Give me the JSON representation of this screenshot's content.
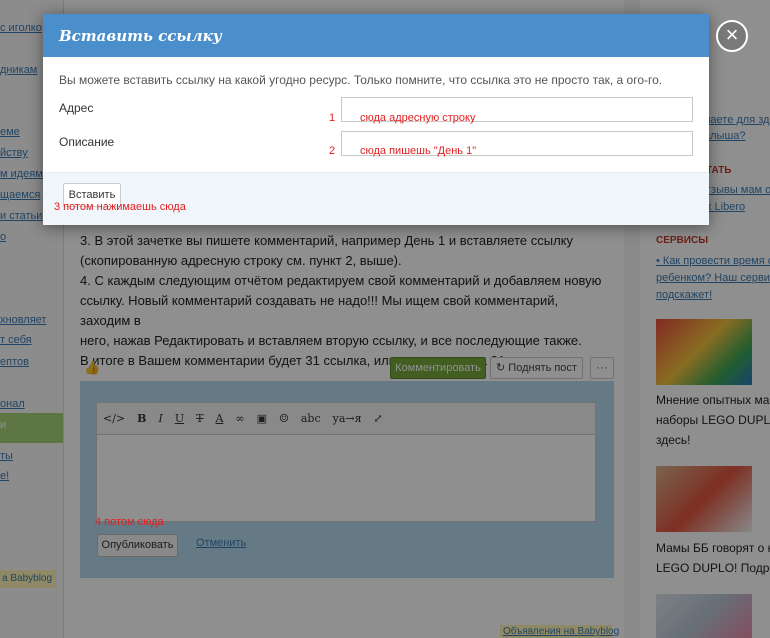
{
  "left_nav": {
    "items": [
      "с иголко",
      "дникам",
      "еме",
      "йству",
      "м идеями",
      "щаемся",
      "и статьи",
      "о",
      "хновляет",
      "т себя",
      "ептов",
      "",
      "онал",
      "и",
      "ты",
      "е!"
    ],
    "ad": "а Babyblog"
  },
  "post": {
    "lines": [
      "3. В этой зачетке вы пишете комментарий, например День 1 и вставляете ссылку",
      "(скопированную адресную строку см. пункт 2, выше).",
      "4. С каждым следующим отчётом редактируем свой комментарий и добавляем новую",
      "ссылку. Новый комментарий создавать не надо!!! Мы ищем свой комментарий, заходим в",
      "него, нажав Редактировать и вставляем вторую ссылку, и все последующие также.",
      "В итоге в Вашем комментарии будет 31 ссылка, или меньше, но на 31день."
    ],
    "comment_button": "Комментировать",
    "lift_button": "Поднять пост",
    "more_button": "···"
  },
  "editor": {
    "toolbar": [
      "</>",
      "B",
      "I",
      "U",
      "T",
      "A",
      "∞",
      "▣",
      "☺",
      "abc",
      "ya→я",
      "⤢"
    ],
    "publish_button": "Опубликовать",
    "cancel_link": "Отменить"
  },
  "ads_bottom": "Объявления на Babyblog",
  "right_col": {
    "top_links": [
      "лаете для здо",
      "алыша?"
    ],
    "heading1": "ТАТЬ",
    "reviews": [
      "тзывы мам о",
      "x Libero"
    ],
    "heading2": "СЕРВИСЫ",
    "service_lines": [
      "• Как провести время с",
      "ребенком? Наш сервис",
      "подскажет!"
    ],
    "item1_lines": [
      "Мнение опытных мам",
      "наборы LEGO DUPLO",
      "здесь!"
    ],
    "item2_lines": [
      "Мамы ББ говорят о н",
      "LEGO DUPLO! Подро"
    ]
  },
  "modal": {
    "title": "Вставить ссылку",
    "description": "Вы можете вставить ссылку на какой угодно ресурс. Только помните, что ссылка это не просто так, а ого-го.",
    "address_label": "Адрес",
    "description_label": "Описание",
    "insert_button": "Вставить",
    "close": "×"
  },
  "annotations": {
    "a1_num": "1",
    "a1": "сюда адресную строку",
    "a2_num": "2",
    "a2": "сюда пишешь \"День 1\"",
    "a3": "3  потом нажимаешь сюда",
    "a4": "4 потом сюда"
  },
  "colors": {
    "header_blue": "#4a8fcc",
    "green_button": "#76a83a",
    "annotation_red": "#e21f1f"
  }
}
